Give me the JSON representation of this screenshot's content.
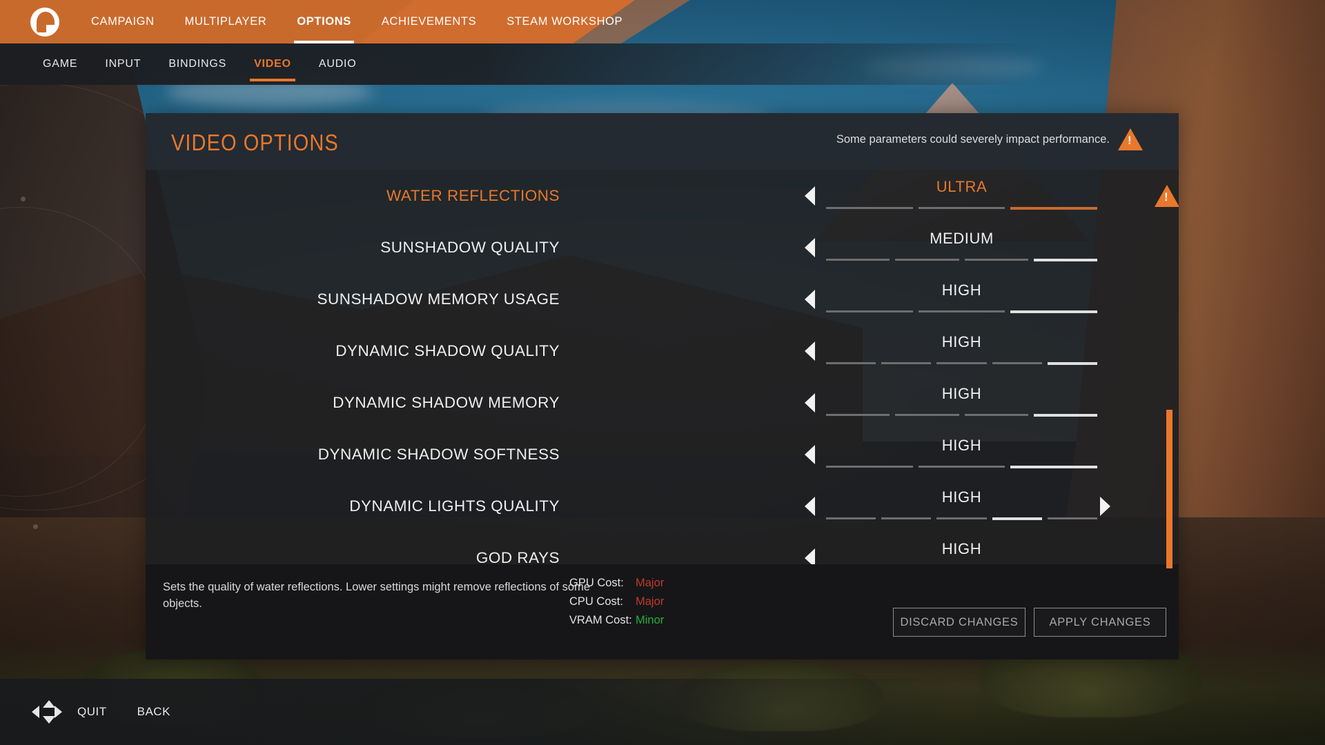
{
  "topnav": {
    "logo": "game-logo",
    "items": [
      {
        "label": "CAMPAIGN",
        "active": false
      },
      {
        "label": "MULTIPLAYER",
        "active": false
      },
      {
        "label": "OPTIONS",
        "active": true
      },
      {
        "label": "ACHIEVEMENTS",
        "active": false
      },
      {
        "label": "STEAM WORKSHOP",
        "active": false
      }
    ]
  },
  "subnav": {
    "items": [
      {
        "label": "GAME",
        "active": false
      },
      {
        "label": "INPUT",
        "active": false
      },
      {
        "label": "BINDINGS",
        "active": false
      },
      {
        "label": "VIDEO",
        "active": true
      },
      {
        "label": "AUDIO",
        "active": false
      }
    ]
  },
  "panel": {
    "title": "VIDEO OPTIONS",
    "warning_text": "Some parameters could severely impact performance.",
    "warning_icon": "warning-triangle-icon"
  },
  "options": [
    {
      "label": "WATER REFLECTIONS",
      "value": "ULTRA",
      "segments": 3,
      "active_segment": 3,
      "selected": true,
      "has_left_arrow": true,
      "has_right_arrow": false,
      "has_warning": true
    },
    {
      "label": "SUNSHADOW QUALITY",
      "value": "MEDIUM",
      "segments": 4,
      "active_segment": 4,
      "selected": false,
      "has_left_arrow": true,
      "has_right_arrow": false,
      "has_warning": false
    },
    {
      "label": "SUNSHADOW MEMORY USAGE",
      "value": "HIGH",
      "segments": 3,
      "active_segment": 3,
      "selected": false,
      "has_left_arrow": true,
      "has_right_arrow": false,
      "has_warning": false
    },
    {
      "label": "DYNAMIC SHADOW QUALITY",
      "value": "HIGH",
      "segments": 5,
      "active_segment": 5,
      "selected": false,
      "has_left_arrow": true,
      "has_right_arrow": false,
      "has_warning": false
    },
    {
      "label": "DYNAMIC SHADOW MEMORY",
      "value": "HIGH",
      "segments": 4,
      "active_segment": 4,
      "selected": false,
      "has_left_arrow": true,
      "has_right_arrow": false,
      "has_warning": false
    },
    {
      "label": "DYNAMIC SHADOW SOFTNESS",
      "value": "HIGH",
      "segments": 3,
      "active_segment": 3,
      "selected": false,
      "has_left_arrow": true,
      "has_right_arrow": false,
      "has_warning": false
    },
    {
      "label": "DYNAMIC LIGHTS QUALITY",
      "value": "HIGH",
      "segments": 5,
      "active_segment": 4,
      "selected": false,
      "has_left_arrow": true,
      "has_right_arrow": true,
      "has_warning": false
    },
    {
      "label": "GOD RAYS",
      "value": "HIGH",
      "segments": 3,
      "active_segment": 3,
      "selected": false,
      "has_left_arrow": true,
      "has_right_arrow": false,
      "has_warning": false
    }
  ],
  "footer": {
    "description": "Sets the quality of water reflections. Lower settings might remove reflections of some objects.",
    "costs": [
      {
        "key": "GPU Cost:",
        "value": "Major",
        "color": "#c0392b"
      },
      {
        "key": "CPU Cost:",
        "value": "Major",
        "color": "#c0392b"
      },
      {
        "key": "VRAM Cost:",
        "value": "Minor",
        "color": "#27ae38"
      }
    ],
    "discard_label": "DISCARD CHANGES",
    "apply_label": "APPLY CHANGES"
  },
  "bottombar": {
    "dpad_icon": "dpad-navigate-icon",
    "items": [
      {
        "label": "QUIT"
      },
      {
        "label": "BACK"
      }
    ]
  },
  "colors": {
    "accent": "#e8782b",
    "topbar": "#c96a2d",
    "panel_bg": "#1e1f21",
    "cost_major": "#c0392b",
    "cost_minor": "#27ae38"
  }
}
